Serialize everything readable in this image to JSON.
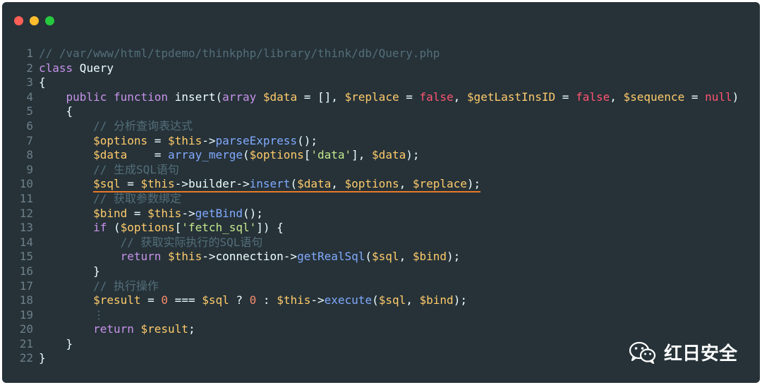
{
  "window": {
    "controls": [
      {
        "name": "close",
        "color": "#ff5f56"
      },
      {
        "name": "minimize",
        "color": "#ffbd2e"
      },
      {
        "name": "zoom",
        "color": "#27c93f"
      }
    ]
  },
  "code": {
    "highlighted_line": 10,
    "lines": [
      {
        "n": "1",
        "tokens": [
          [
            "cm",
            "// /var/www/html/tpdemo/thinkphp/library/think/db/Query.php"
          ]
        ]
      },
      {
        "n": "2",
        "tokens": [
          [
            "kw",
            "class"
          ],
          [
            "pl",
            " Query"
          ]
        ]
      },
      {
        "n": "3",
        "tokens": [
          [
            "pl",
            "{"
          ]
        ]
      },
      {
        "n": "4",
        "tokens": [
          [
            "pl",
            "    "
          ],
          [
            "kw",
            "public"
          ],
          [
            "pl",
            " "
          ],
          [
            "kw",
            "function"
          ],
          [
            "pl",
            " insert("
          ],
          [
            "kw",
            "array"
          ],
          [
            "pl",
            " "
          ],
          [
            "var",
            "$data"
          ],
          [
            "pl",
            " = [], "
          ],
          [
            "var",
            "$replace"
          ],
          [
            "pl",
            " = "
          ],
          [
            "bool",
            "false"
          ],
          [
            "pl",
            ", "
          ],
          [
            "var",
            "$getLastInsID"
          ],
          [
            "pl",
            " = "
          ],
          [
            "bool",
            "false"
          ],
          [
            "pl",
            ", "
          ],
          [
            "var",
            "$sequence"
          ],
          [
            "pl",
            " = "
          ],
          [
            "bool",
            "null"
          ],
          [
            "pl",
            ")"
          ]
        ]
      },
      {
        "n": "5",
        "tokens": [
          [
            "pl",
            "    {"
          ]
        ]
      },
      {
        "n": "6",
        "tokens": [
          [
            "pl",
            "        "
          ],
          [
            "cm",
            "// 分析查询表达式"
          ]
        ]
      },
      {
        "n": "7",
        "tokens": [
          [
            "pl",
            "        "
          ],
          [
            "var",
            "$options"
          ],
          [
            "pl",
            " = "
          ],
          [
            "var",
            "$this"
          ],
          [
            "pl",
            "->"
          ],
          [
            "fn",
            "parseExpress"
          ],
          [
            "pl",
            "();"
          ]
        ]
      },
      {
        "n": "8",
        "tokens": [
          [
            "pl",
            "        "
          ],
          [
            "var",
            "$data"
          ],
          [
            "pl",
            "    = "
          ],
          [
            "fn",
            "array_merge"
          ],
          [
            "pl",
            "("
          ],
          [
            "var",
            "$options"
          ],
          [
            "pl",
            "["
          ],
          [
            "str",
            "'data'"
          ],
          [
            "pl",
            "], "
          ],
          [
            "var",
            "$data"
          ],
          [
            "pl",
            ");"
          ]
        ]
      },
      {
        "n": "9",
        "tokens": [
          [
            "pl",
            "        "
          ],
          [
            "cm",
            "// 生成SQL语句"
          ]
        ]
      },
      {
        "n": "10",
        "tokens": [
          [
            "pl",
            "        "
          ],
          [
            "var",
            "$sql"
          ],
          [
            "pl",
            " = "
          ],
          [
            "var",
            "$this"
          ],
          [
            "pl",
            "->"
          ],
          [
            "pl",
            "builder"
          ],
          [
            "pl",
            "->"
          ],
          [
            "fn",
            "insert"
          ],
          [
            "pl",
            "("
          ],
          [
            "var",
            "$data"
          ],
          [
            "pl",
            ", "
          ],
          [
            "var",
            "$options"
          ],
          [
            "pl",
            ", "
          ],
          [
            "var",
            "$replace"
          ],
          [
            "pl",
            ");"
          ]
        ]
      },
      {
        "n": "11",
        "tokens": [
          [
            "pl",
            "        "
          ],
          [
            "cm",
            "// 获取参数绑定"
          ]
        ]
      },
      {
        "n": "12",
        "tokens": [
          [
            "pl",
            "        "
          ],
          [
            "var",
            "$bind"
          ],
          [
            "pl",
            " = "
          ],
          [
            "var",
            "$this"
          ],
          [
            "pl",
            "->"
          ],
          [
            "fn",
            "getBind"
          ],
          [
            "pl",
            "();"
          ]
        ]
      },
      {
        "n": "13",
        "tokens": [
          [
            "pl",
            "        "
          ],
          [
            "kw",
            "if"
          ],
          [
            "pl",
            " ("
          ],
          [
            "var",
            "$options"
          ],
          [
            "pl",
            "["
          ],
          [
            "str",
            "'fetch_sql'"
          ],
          [
            "pl",
            "]) {"
          ]
        ]
      },
      {
        "n": "14",
        "tokens": [
          [
            "pl",
            "            "
          ],
          [
            "cm",
            "// 获取实际执行的SQL语句"
          ]
        ]
      },
      {
        "n": "15",
        "tokens": [
          [
            "pl",
            "            "
          ],
          [
            "kw",
            "return"
          ],
          [
            "pl",
            " "
          ],
          [
            "var",
            "$this"
          ],
          [
            "pl",
            "->"
          ],
          [
            "pl",
            "connection"
          ],
          [
            "pl",
            "->"
          ],
          [
            "fn",
            "getRealSql"
          ],
          [
            "pl",
            "("
          ],
          [
            "var",
            "$sql"
          ],
          [
            "pl",
            ", "
          ],
          [
            "var",
            "$bind"
          ],
          [
            "pl",
            ");"
          ]
        ]
      },
      {
        "n": "16",
        "tokens": [
          [
            "pl",
            "        }"
          ]
        ]
      },
      {
        "n": "17",
        "tokens": [
          [
            "pl",
            "        "
          ],
          [
            "cm",
            "// 执行操作"
          ]
        ]
      },
      {
        "n": "18",
        "tokens": [
          [
            "pl",
            "        "
          ],
          [
            "var",
            "$result"
          ],
          [
            "pl",
            " = "
          ],
          [
            "num",
            "0"
          ],
          [
            "pl",
            " === "
          ],
          [
            "var",
            "$sql"
          ],
          [
            "pl",
            " ? "
          ],
          [
            "num",
            "0"
          ],
          [
            "pl",
            " : "
          ],
          [
            "var",
            "$this"
          ],
          [
            "pl",
            "->"
          ],
          [
            "fn",
            "execute"
          ],
          [
            "pl",
            "("
          ],
          [
            "var",
            "$sql"
          ],
          [
            "pl",
            ", "
          ],
          [
            "var",
            "$bind"
          ],
          [
            "pl",
            ");"
          ]
        ]
      },
      {
        "n": "19",
        "tokens": [
          [
            "pl",
            "        "
          ],
          [
            "cm",
            "⋮"
          ]
        ]
      },
      {
        "n": "20",
        "tokens": [
          [
            "pl",
            "        "
          ],
          [
            "kw",
            "return"
          ],
          [
            "pl",
            " "
          ],
          [
            "var",
            "$result"
          ],
          [
            "pl",
            ";"
          ]
        ]
      },
      {
        "n": "21",
        "tokens": [
          [
            "pl",
            "    }"
          ]
        ]
      },
      {
        "n": "22",
        "tokens": [
          [
            "pl",
            "}"
          ]
        ]
      }
    ]
  },
  "watermark": {
    "icon": "wechat-icon",
    "text": "红日安全"
  }
}
